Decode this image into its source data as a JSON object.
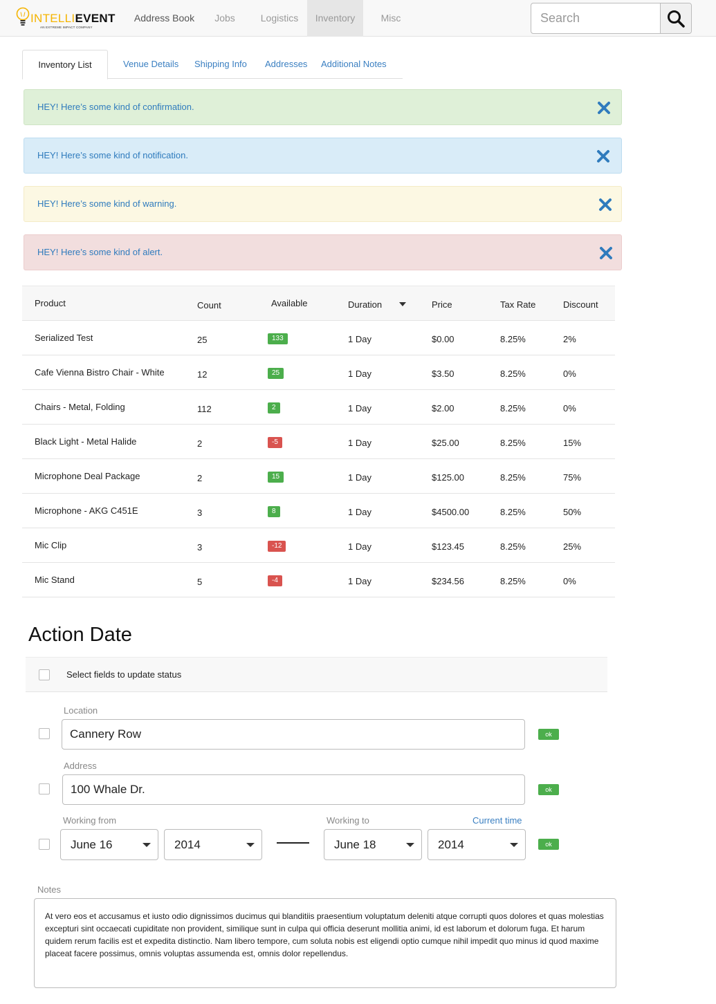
{
  "brand": {
    "logo_part1": "INTELLI",
    "logo_part2": "EVENT",
    "tagline": "AN EXTREME IMPACT COMPANY"
  },
  "nav": {
    "items": [
      "Address Book",
      "Jobs",
      "Logistics",
      "Inventory",
      "Misc"
    ],
    "active": "Inventory"
  },
  "search": {
    "placeholder": "Search"
  },
  "tabs": [
    "Inventory List",
    "Venue Details",
    "Shipping Info",
    "Addresses",
    "Additional Notes"
  ],
  "alerts": {
    "confirmation": "HEY! Here’s some kind of confirmation.",
    "notification": "HEY! Here’s some kind of notification.",
    "warning": "HEY! Here’s some kind of warning.",
    "alert": "HEY! Here’s some kind of alert."
  },
  "colors": {
    "success_badge": "#4cae4c",
    "danger_badge": "#d9534f",
    "link": "#3a7fc1",
    "close_icon": "#2f7bbd",
    "logo_yellow": "#f5b400"
  },
  "table": {
    "headers": {
      "product": "Product",
      "count": "Count",
      "available": "Available",
      "duration": "Duration",
      "price": "Price",
      "tax_rate": "Tax Rate",
      "discount": "Discount"
    },
    "rows": [
      {
        "product": "Serialized Test",
        "count": "25",
        "available": "133",
        "duration": "1 Day",
        "price": "$0.00",
        "tax_rate": "8.25%",
        "discount": "2%"
      },
      {
        "product": "Cafe Vienna Bistro Chair - White",
        "count": "12",
        "available": "25",
        "duration": "1 Day",
        "price": "$3.50",
        "tax_rate": "8.25%",
        "discount": "0%"
      },
      {
        "product": "Chairs - Metal, Folding",
        "count": "112",
        "available": "2",
        "duration": "1 Day",
        "price": "$2.00",
        "tax_rate": "8.25%",
        "discount": "0%"
      },
      {
        "product": "Black Light - Metal Halide",
        "count": "2",
        "available": "-5",
        "duration": "1 Day",
        "price": "$25.00",
        "tax_rate": "8.25%",
        "discount": "15%"
      },
      {
        "product": "Microphone Deal Package",
        "count": "2",
        "available": "15",
        "duration": "1 Day",
        "price": "$125.00",
        "tax_rate": "8.25%",
        "discount": "75%"
      },
      {
        "product": "Microphone - AKG C451E",
        "count": "3",
        "available": "8",
        "duration": "1 Day",
        "price": "$4500.00",
        "tax_rate": "8.25%",
        "discount": "50%"
      },
      {
        "product": "Mic Clip",
        "count": "3",
        "available": "-12",
        "duration": "1 Day",
        "price": "$123.45",
        "tax_rate": "8.25%",
        "discount": "25%"
      },
      {
        "product": "Mic Stand",
        "count": "5",
        "available": "-4",
        "duration": "1 Day",
        "price": "$234.56",
        "tax_rate": "8.25%",
        "discount": "0%"
      }
    ]
  },
  "action_date": {
    "title": "Action Date",
    "select_all_label": "Select fields to update status",
    "location_label": "Location",
    "location_value": "Cannery Row",
    "address_label": "Address",
    "address_value": "100 Whale Dr.",
    "working_from_label": "Working from",
    "working_to_label": "Working to",
    "current_time_link": "Current time",
    "from_month": "June 16",
    "from_year": "2014",
    "to_month": "June 18",
    "to_year": "2014",
    "ok_label": "ok",
    "notes_label": "Notes",
    "notes_value": "At vero eos et accusamus et iusto odio dignissimos ducimus qui blanditiis praesentium voluptatum deleniti atque corrupti quos dolores et quas molestias excepturi sint occaecati cupiditate non provident, similique sunt in culpa qui officia deserunt mollitia animi, id est laborum et dolorum fuga. Et harum quidem rerum facilis est et expedita distinctio. Nam libero tempore, cum soluta nobis est eligendi optio cumque nihil impedit quo minus id quod maxime placeat facere possimus, omnis voluptas assumenda est, omnis dolor repellendus."
  }
}
